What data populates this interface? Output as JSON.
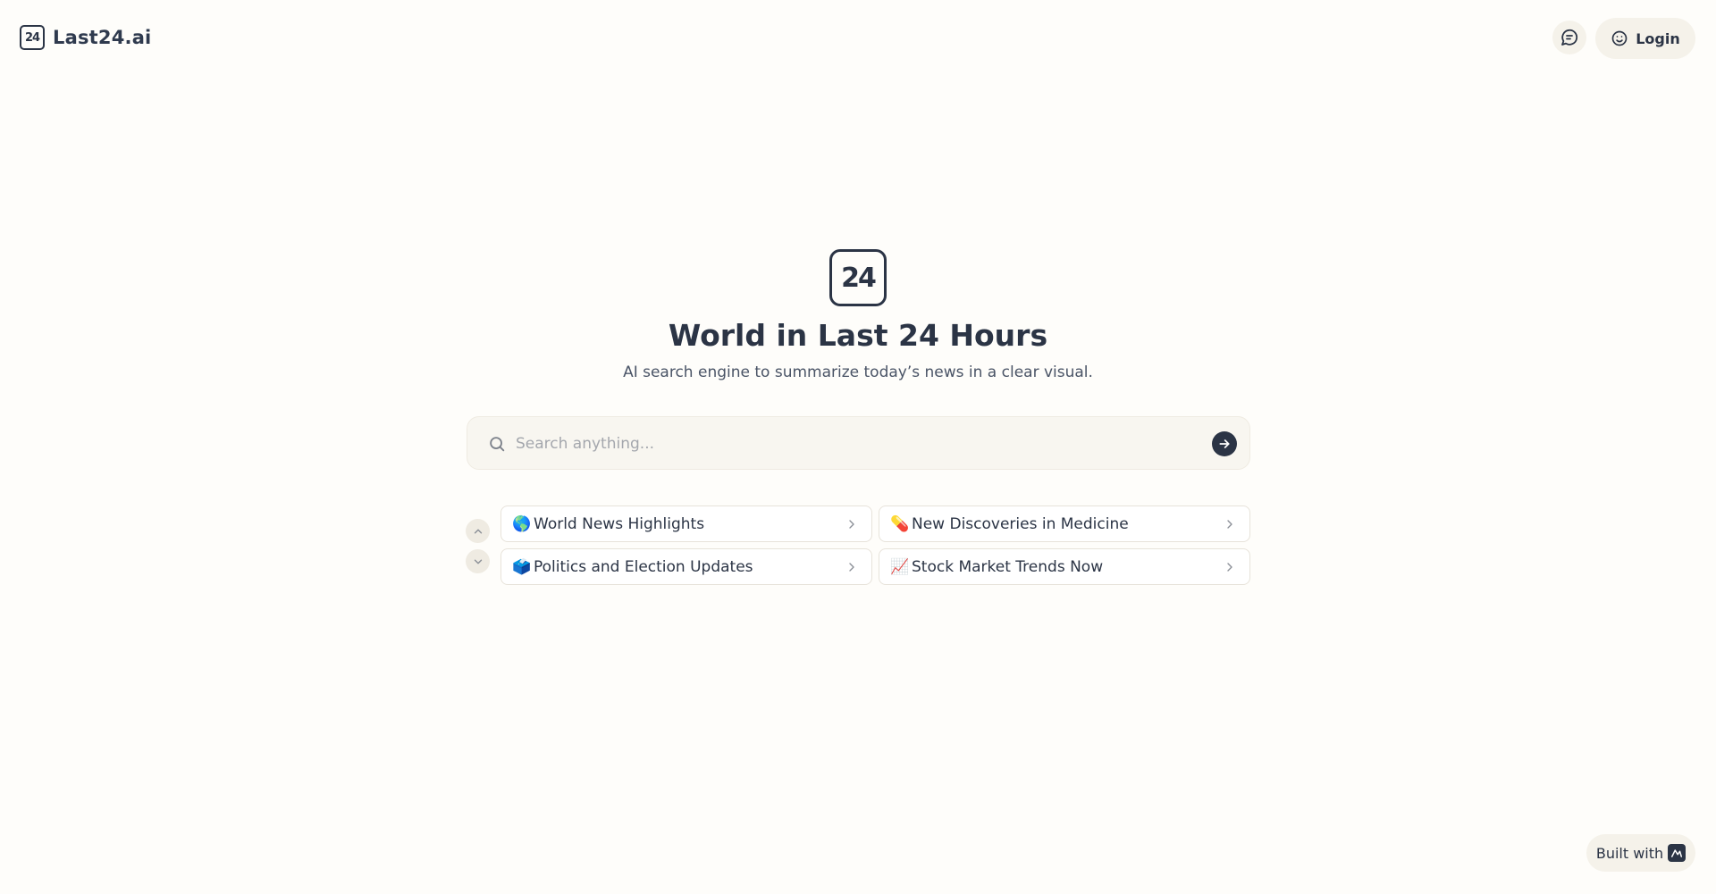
{
  "header": {
    "brand_logo_text": "24",
    "brand_name": "Last24.ai",
    "chat_icon": "message-square-icon",
    "login_label": "Login",
    "login_icon": "smile-icon"
  },
  "hero": {
    "logo_text": "24",
    "title": "World in Last 24 Hours",
    "subtitle": "AI search engine to summarize today’s news in a clear visual."
  },
  "search": {
    "placeholder": "Search anything...",
    "value": "",
    "icon": "search-icon",
    "submit_icon": "arrow-right-icon"
  },
  "suggestions": [
    {
      "emoji": "🌎",
      "label": "World News Highlights"
    },
    {
      "emoji": "💊",
      "label": "New Discoveries in Medicine"
    },
    {
      "emoji": "🗳️",
      "label": "Politics and Election Updates"
    },
    {
      "emoji": "📈",
      "label": "Stock Market Trends Now"
    }
  ],
  "footer": {
    "built_with_label": "Built with",
    "built_with_icon": "builder-logo-icon"
  },
  "colors": {
    "background": "#fefdfa",
    "text": "#2b3445",
    "accent": "#2b3445",
    "pill_bg": "#f5f2ea"
  }
}
